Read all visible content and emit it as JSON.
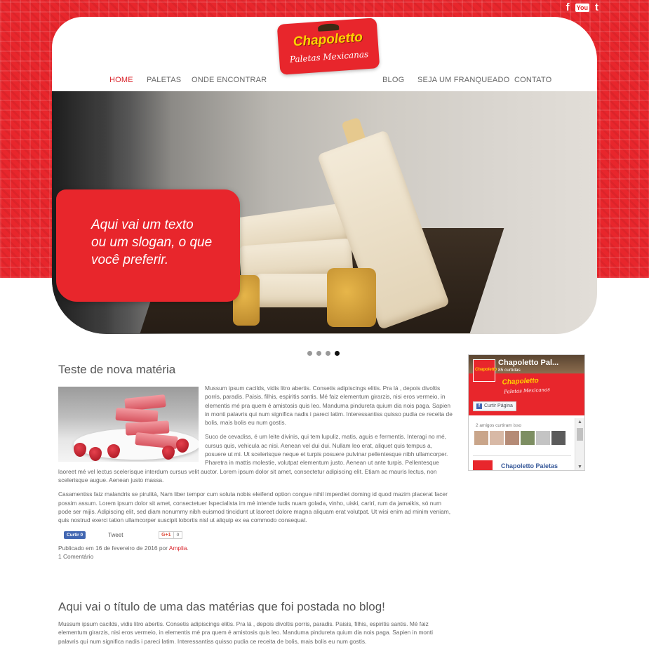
{
  "social": {
    "facebook": "f",
    "youtube": "You",
    "twitter": "t"
  },
  "logo": {
    "brand": "Chapoletto",
    "subtitle": "Paletas Mexicanas"
  },
  "nav": {
    "home": "HOME",
    "paletas": "PALETAS",
    "onde": "ONDE ENCONTRAR",
    "blog": "BLOG",
    "franqueado": "SEJA UM FRANQUEADO",
    "contato": "CONTATO"
  },
  "hero": {
    "slogan_line1": "Aqui vai um texto",
    "slogan_line2": "ou um slogan, o que",
    "slogan_line3": "você preferir.",
    "active_slide": 4,
    "slide_count": 4
  },
  "article1": {
    "title": "Teste de nova matéria",
    "p1": "Mussum ipsum cacilds, vidis litro abertis. Consetis adipiscings elitis. Pra lá , depois divoltis porris, paradis. Paisis, filhis, espiritis santis. Mé faiz elementum girarzis, nisi eros vermeio, in elementis mé pra quem é amistosis quis leo. Manduma pindureta quium dia nois paga. Sapien in monti palavris qui num significa nadis i pareci latim. Interessantiss quisso pudia ce receita de bolis, mais bolis eu num gostis.",
    "p2": "Suco de cevadiss, é um leite divinis, qui tem lupuliz, matis, aguis e fermentis. Interagi no mé, cursus quis, vehicula ac nisi. Aenean vel dui dui. Nullam leo erat, aliquet quis tempus a, posuere ut mi. Ut scelerisque neque et turpis posuere pulvinar pellentesque nibh ullamcorper. Pharetra in mattis molestie, volutpat elementum justo. Aenean ut ante turpis. Pellentesque laoreet mé vel lectus scelerisque interdum cursus velit auctor. Lorem ipsum dolor sit amet, consectetur adipiscing elit. Etiam ac mauris lectus, non scelerisque augue. Aenean justo massa.",
    "p3": "Casamentiss faiz malandris se pirulitá, Nam liber tempor cum soluta nobis eleifend option congue nihil imperdiet doming id quod mazim placerat facer possim assum. Lorem ipsum dolor sit amet, consectetuer Ispecialista im mé intende tudis nuam golada, vinho, uiski, carirí, rum da jamaikis, só num pode ser mijis. Adipiscing elit, sed diam nonummy nibh euismod tincidunt ut laoreet dolore magna aliquam erat volutpat. Ut wisi enim ad minim veniam, quis nostrud exerci tation ullamcorper suscipit lobortis nisl ut aliquip ex ea commodo consequat.",
    "like_label": "Curtir 0",
    "tweet_label": "Tweet",
    "gplus_label": "G+1",
    "gplus_count": "0",
    "published_prefix": "Publicado em 16 de fevereiro de 2016 por ",
    "author": "Amplia",
    "published_suffix": ".",
    "comments": "1 Comentário"
  },
  "article2": {
    "title": "Aqui vai o título de uma das matérias que foi postada no blog!",
    "p1": "Mussum ipsum cacilds, vidis litro abertis. Consetis adipiscings elitis. Pra lá , depois divoltis porris, paradis. Paisis, filhis, espiritis santis. Mé faiz elementum girarzis, nisi eros vermeio, in elementis mé pra quem é amistosis quis leo. Manduma pindureta quium dia nois paga. Sapien in monti palavris qui num significa nadis i pareci latim. Interessantiss quisso pudia ce receita de bolis, mais bolis eu num gostis."
  },
  "facebook": {
    "page_name": "Chapoletto Pal...",
    "likes": "85 curtidas",
    "mini_brand": "Chapoletto",
    "mini_sub": "Paletas Mexicanas",
    "avatar_text": "Chapoletto",
    "like_button": "Curtir Página",
    "friends": "2 amigos curtiram isso",
    "post_name": "Chapoletto Paletas"
  },
  "colors": {
    "brand_red": "#e8262c",
    "logo_yellow": "#ffd200",
    "nav_active": "#d9232a"
  }
}
